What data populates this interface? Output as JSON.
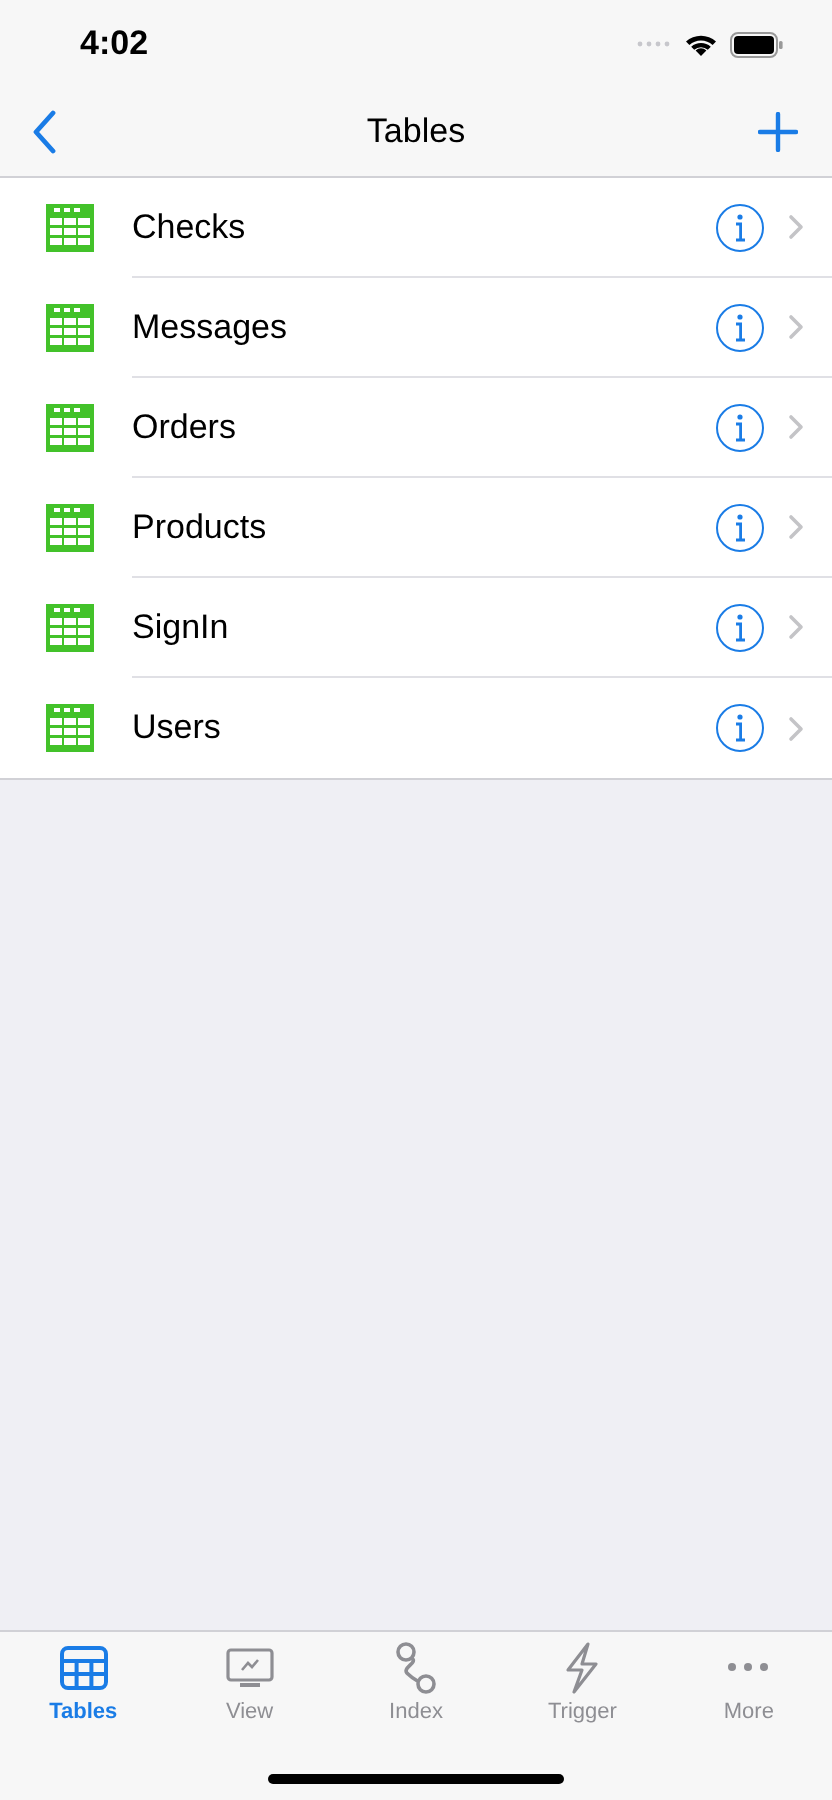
{
  "status_bar": {
    "time": "4:02"
  },
  "nav": {
    "title": "Tables"
  },
  "rows": [
    {
      "label": "Checks"
    },
    {
      "label": "Messages"
    },
    {
      "label": "Orders"
    },
    {
      "label": "Products"
    },
    {
      "label": "SignIn"
    },
    {
      "label": "Users"
    }
  ],
  "tab_bar": [
    {
      "label": "Tables",
      "kind": "grid",
      "selected": true
    },
    {
      "label": "View",
      "kind": "monitor",
      "selected": false
    },
    {
      "label": "Index",
      "kind": "link",
      "selected": false
    },
    {
      "label": "Trigger",
      "kind": "bolt",
      "selected": false
    },
    {
      "label": "More",
      "kind": "dots",
      "selected": false
    }
  ]
}
